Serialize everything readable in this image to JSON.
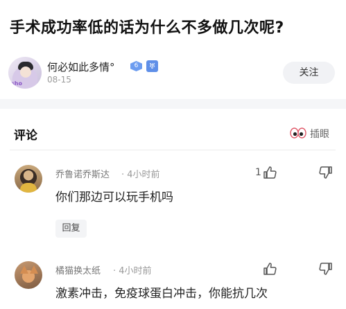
{
  "question": {
    "title": "手术成功率低的话为什么不多做几次呢?"
  },
  "author": {
    "name": "何必如此多情°",
    "level": "6",
    "medal": "♅",
    "date": "08-15",
    "avatar_tag": "sho",
    "follow_label": "关注"
  },
  "comments_section": {
    "title": "评论",
    "insert_eye_label": "插眼"
  },
  "comments": [
    {
      "username": "乔鲁诺乔斯达",
      "time": "· 4小时前",
      "like_count": "1",
      "text": "你们那边可以玩手机吗",
      "reply_label": "回复"
    },
    {
      "username": "橘猫换太纸",
      "time": "· 4小时前",
      "like_count": "",
      "text": "激素冲击，免疫球蛋白冲击，你能抗几次"
    }
  ],
  "colors": {
    "badge_blue": "#6c9cf0",
    "follow_bg": "#f1f2f5",
    "divider": "#f5f6f8"
  }
}
